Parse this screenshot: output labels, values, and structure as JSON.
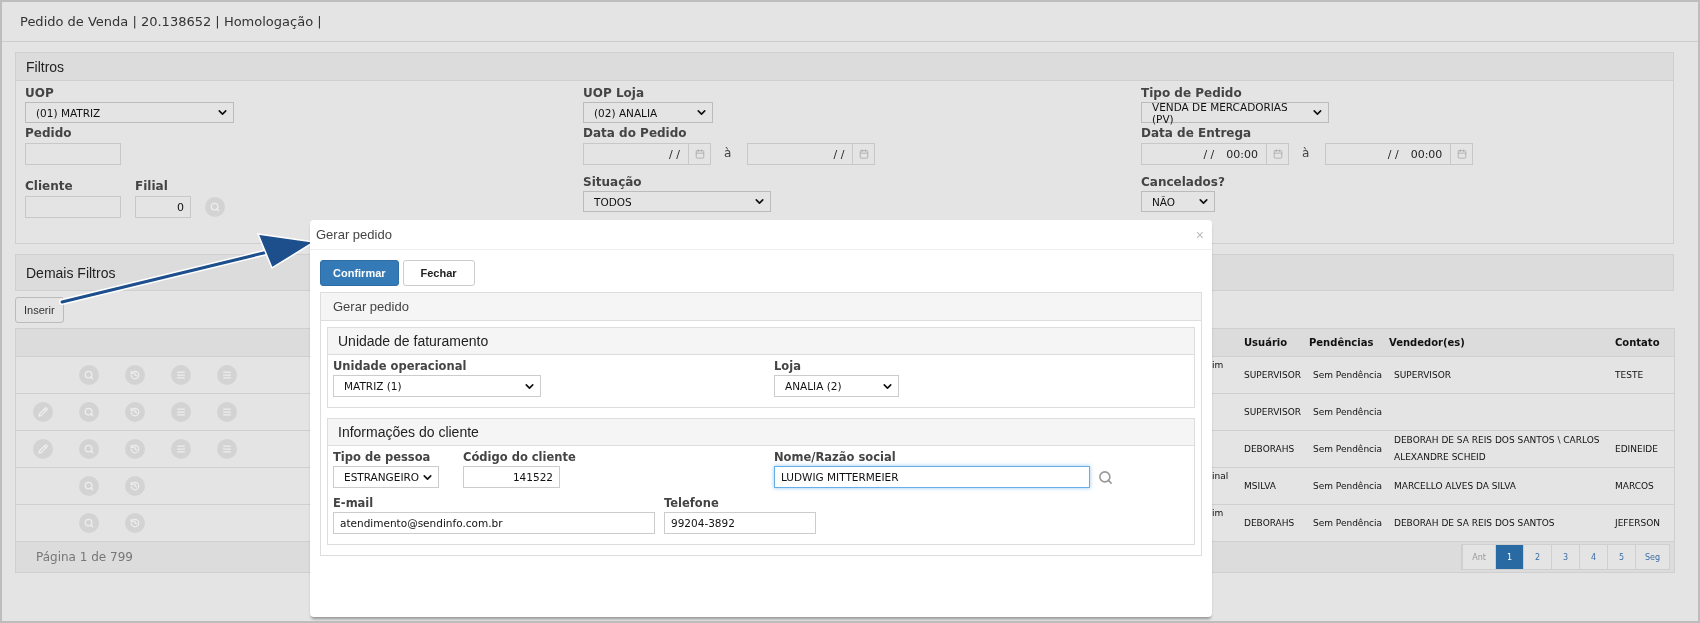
{
  "page_title": "Pedido de Venda | 20.138652 | Homologação |",
  "filters": {
    "title": "Filtros",
    "columns": [
      [
        {
          "kind": "select",
          "label": "UOP",
          "value": "(01) MATRIZ"
        },
        {
          "kind": "input",
          "label": "Pedido"
        },
        {
          "kind": "client",
          "label": "Cliente",
          "label2": "Filial",
          "value2": "0"
        }
      ],
      [
        {
          "kind": "select",
          "label": "UOP Loja",
          "value": "(02) ANALIA"
        },
        {
          "kind": "dates",
          "label": "Data do Pedido",
          "from": "/ /",
          "to": "/ /",
          "sep": "à"
        },
        {
          "kind": "select",
          "label": "Situação",
          "value": "TODOS"
        }
      ],
      [
        {
          "kind": "select",
          "label": "Tipo de Pedido",
          "value": "VENDA DE MERCADORIAS (PV)"
        },
        {
          "kind": "dates",
          "label": "Data de Entrega",
          "from": "/ /",
          "to": "/ /",
          "time_from": "00:00",
          "time_to": "00:00",
          "sep": "à"
        },
        {
          "kind": "select",
          "label": "Cancelados?",
          "value": "NÃO"
        }
      ]
    ]
  },
  "more_filters": {
    "title": "Demais Filtros"
  },
  "insert_button": "Inserir",
  "table": {
    "columns": [
      "Usuário",
      "Pendências",
      "Vendedor(es)",
      "Contato"
    ],
    "rows": [
      {
        "actions": [
          {
            "kind": "search"
          },
          {
            "kind": "history"
          },
          {
            "kind": "menu"
          },
          {
            "kind": "menu"
          }
        ],
        "column_cut": "im",
        "usuario": "SUPERVISOR",
        "pendencias": "Sem Pendência",
        "vendedores": "SUPERVISOR",
        "contato": "TESTE"
      },
      {
        "actions": [
          {
            "kind": "edit"
          },
          {
            "kind": "search"
          },
          {
            "kind": "history"
          },
          {
            "kind": "menu"
          },
          {
            "kind": "menu"
          }
        ],
        "usuario": "SUPERVISOR",
        "pendencias": "Sem Pendência"
      },
      {
        "actions": [
          {
            "kind": "edit"
          },
          {
            "kind": "search"
          },
          {
            "kind": "history"
          },
          {
            "kind": "menu"
          },
          {
            "kind": "menu"
          }
        ],
        "usuario": "DEBORAHS",
        "pendencias": "Sem Pendência",
        "vendedores": "DEBORAH DE SA REIS DOS SANTOS \\ CARLOS ALEXANDRE SCHEID",
        "contato": "EDINEIDE"
      },
      {
        "actions": [
          {
            "kind": "search"
          },
          {
            "kind": "history"
          }
        ],
        "column_cut": "inal",
        "usuario": "MSILVA",
        "pendencias": "Sem Pendência",
        "vendedores": "MARCELLO ALVES DA SILVA",
        "contato": "MARCOS"
      },
      {
        "actions": [
          {
            "kind": "search"
          },
          {
            "kind": "history"
          }
        ],
        "column_cut": "im",
        "usuario": "DEBORAHS",
        "pendencias": "Sem Pendência",
        "vendedores": "DEBORAH DE SA REIS DOS SANTOS",
        "contato": "JEFERSON"
      }
    ],
    "page_info": "Página 1 de 799",
    "pagination": [
      {
        "label": "Ant",
        "selected": false,
        "disabled": true
      },
      {
        "label": "1",
        "selected": true,
        "disabled": false
      },
      {
        "label": "2",
        "selected": false,
        "disabled": false
      },
      {
        "label": "3",
        "selected": false,
        "disabled": false
      },
      {
        "label": "4",
        "selected": false,
        "disabled": false
      },
      {
        "label": "5",
        "selected": false,
        "disabled": false
      },
      {
        "label": "Seg",
        "selected": false,
        "disabled": false
      }
    ]
  },
  "dialog": {
    "title": "Gerar pedido",
    "close": "×",
    "buttons": [
      {
        "label": "Confirmar",
        "primary": true
      },
      {
        "label": "Fechar",
        "primary": false
      }
    ],
    "panel_title": "Gerar pedido",
    "billing": {
      "title": "Unidade de faturamento",
      "unit_label": "Unidade operacional",
      "unit_value": "MATRIZ (1)",
      "store_label": "Loja",
      "store_value": "ANALIA (2)"
    },
    "client": {
      "title": "Informações do cliente",
      "person_type_label": "Tipo de pessoa",
      "person_type_value": "ESTRANGEIRO",
      "code_label": "Código do cliente",
      "code_value": "141522",
      "name_label": "Nome/Razão social",
      "name_value": "LUDWIG MITTERMEIER",
      "name_focused": true,
      "email_label": "E-mail",
      "email_value": "atendimento@sendinfo.com.br",
      "phone_label": "Telefone",
      "phone_value": "99204-3892"
    }
  }
}
